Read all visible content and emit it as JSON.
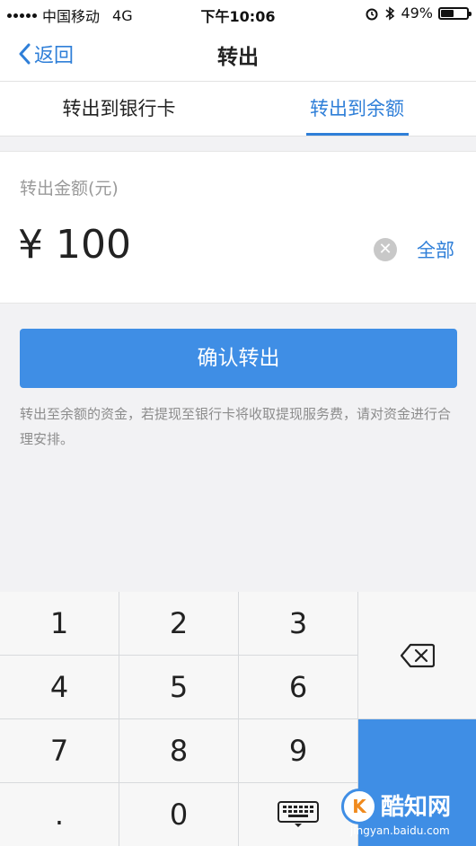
{
  "status_bar": {
    "carrier": "中国移动",
    "network": "4G",
    "time": "下午10:06",
    "battery_text": "49%",
    "battery_level": 0.49
  },
  "nav": {
    "back_label": "返回",
    "title": "转出"
  },
  "tabs": [
    {
      "label": "转出到银行卡",
      "active": false
    },
    {
      "label": "转出到余额",
      "active": true
    }
  ],
  "amount": {
    "label": "转出金额(元)",
    "currency": "¥",
    "value": "100",
    "all_label": "全部"
  },
  "confirm_label": "确认转出",
  "notice": "转出至余额的资金，若提现至银行卡将收取提现服务费，请对资金进行合理安排。",
  "keypad": {
    "keys": [
      "1",
      "2",
      "3",
      "4",
      "5",
      "6",
      "7",
      "8",
      "9",
      ".",
      "0"
    ]
  },
  "watermark": {
    "brand": "酷知网",
    "url": "jingyan.baidu.com"
  },
  "colors": {
    "accent": "#3f8ee5",
    "link": "#2f7fd8"
  }
}
